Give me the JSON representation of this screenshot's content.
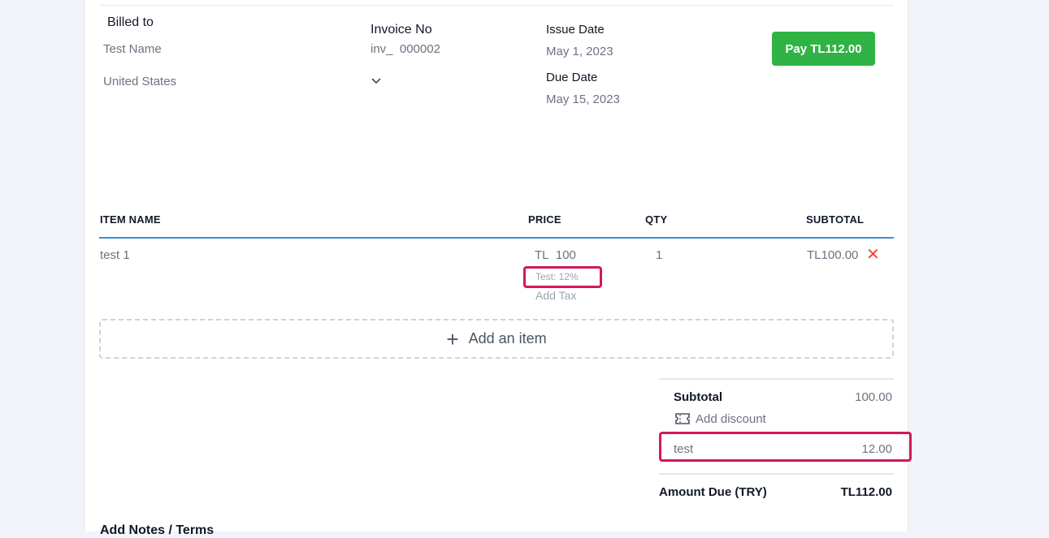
{
  "billed_to": {
    "label": "Billed to",
    "name": "Test Name",
    "country": "United States"
  },
  "invoice": {
    "label": "Invoice No",
    "prefix": "inv_",
    "number": "000002"
  },
  "dates": {
    "issue_label": "Issue Date",
    "issue_value": "May 1, 2023",
    "due_label": "Due Date",
    "due_value": "May 15, 2023"
  },
  "pay_button": {
    "label": "Pay TL112.00"
  },
  "table": {
    "headers": {
      "item": "ITEM NAME",
      "price": "PRICE",
      "qty": "QTY",
      "subtotal": "SUBTOTAL"
    },
    "rows": [
      {
        "name": "test 1",
        "currency": "TL",
        "price": "100",
        "tax": "Test: 12%",
        "add_tax": "Add Tax",
        "qty": "1",
        "subtotal": "TL100.00"
      }
    ]
  },
  "add_item": {
    "label": "Add an item"
  },
  "totals": {
    "subtotal_label": "Subtotal",
    "subtotal_value": "100.00",
    "discount_label": "Add discount",
    "tax_label": "test",
    "tax_value": "12.00",
    "amount_due_label": "Amount Due (TRY)",
    "amount_due_value": "TL112.00"
  },
  "notes": {
    "label": "Add Notes / Terms"
  },
  "colors": {
    "pay": "#2fb344",
    "highlight": "#d3185b",
    "accent": "#3b8ed8",
    "remove": "#ef4444"
  },
  "icons": {
    "country_dropdown": "chevron-down-icon",
    "remove_row": "close-icon",
    "discount": "ticket-icon",
    "add_item": "plus-icon"
  }
}
